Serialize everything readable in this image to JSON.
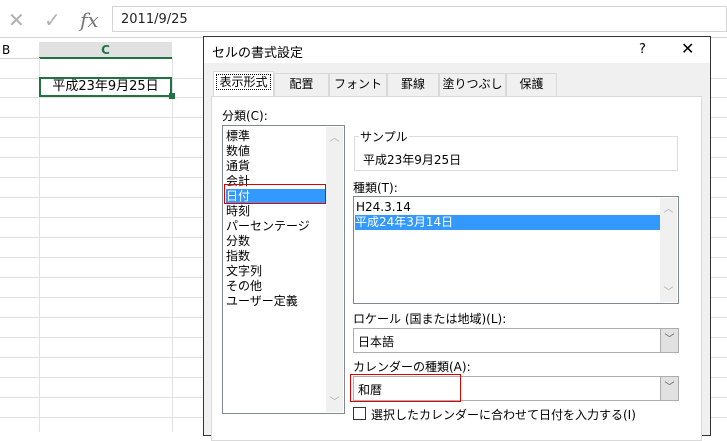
{
  "formula_bar": {
    "cancel_icon": "✕",
    "enter_icon": "✓",
    "fx_label": "fx",
    "value": "2011/9/25"
  },
  "sheet": {
    "columns": [
      "B",
      "C"
    ],
    "selected_cell_value": "平成23年9月25日"
  },
  "dialog": {
    "title": "セルの書式設定",
    "help": "?",
    "close": "✕",
    "tabs": [
      "表示形式",
      "配置",
      "フォント",
      "罫線",
      "塗りつぶし",
      "保護"
    ],
    "category_label": "分類(C):",
    "categories": [
      "標準",
      "数値",
      "通貨",
      "会計",
      "日付",
      "時刻",
      "パーセンテージ",
      "分数",
      "指数",
      "文字列",
      "その他",
      "ユーザー定義"
    ],
    "selected_category": "日付",
    "sample_label": "サンプル",
    "sample_value": "平成23年9月25日",
    "type_label": "種類(T):",
    "types": [
      "H24.3.14",
      "平成24年3月14日"
    ],
    "locale_label": "ロケール (国または地域)(L):",
    "locale_value": "日本語",
    "calendar_label": "カレンダーの種類(A):",
    "calendar_value": "和暦",
    "checkbox_label": "選択したカレンダーに合わせて日付を入力する(I)",
    "checkbox_checked": false
  },
  "colors": {
    "accent": "#217346",
    "selection": "#3399ff",
    "highlight_box": "#e00000"
  }
}
